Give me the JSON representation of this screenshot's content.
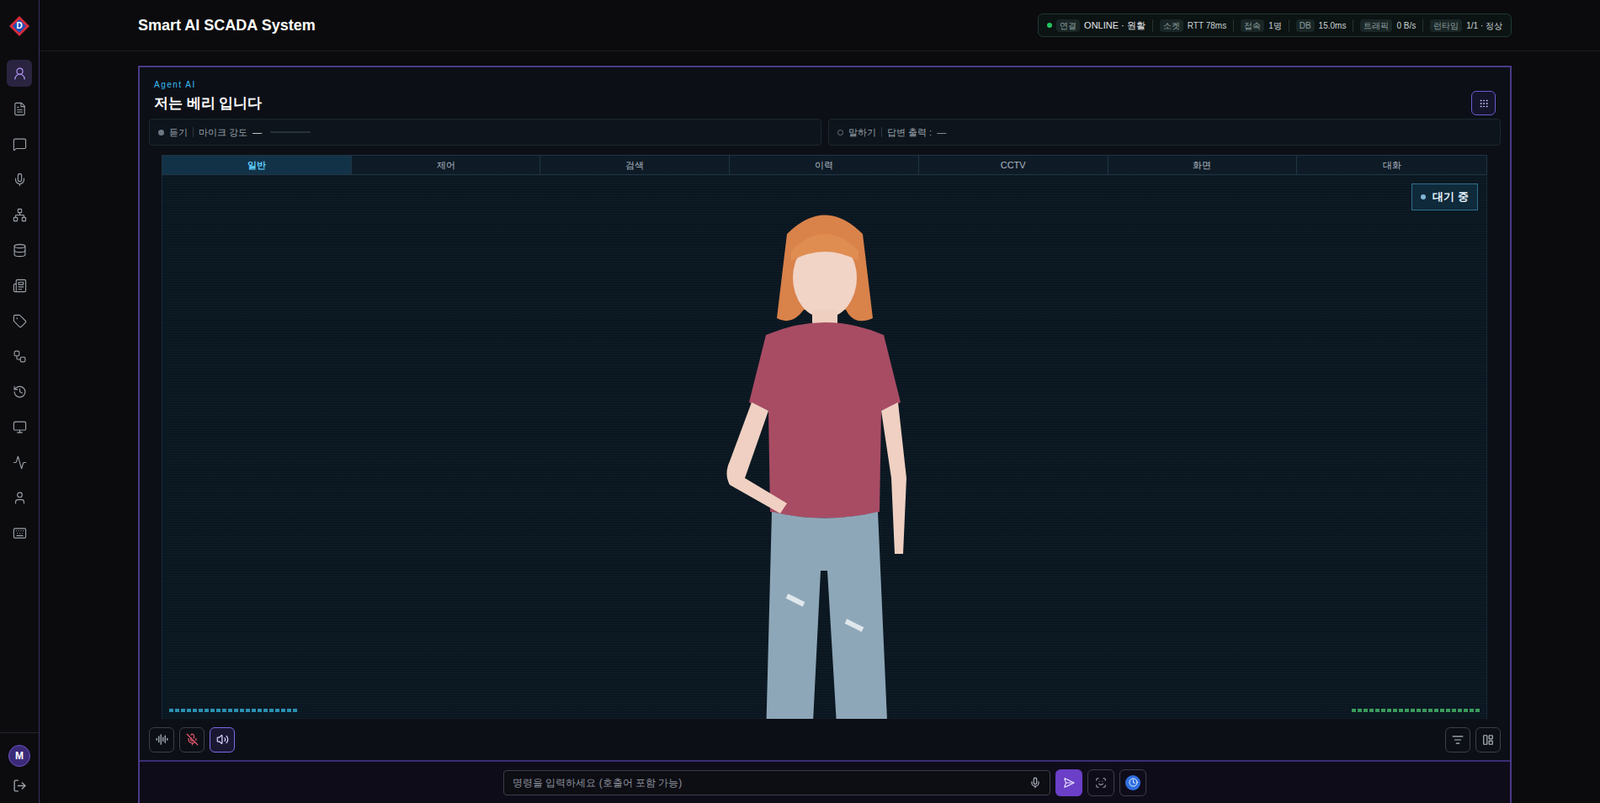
{
  "sidebar": {
    "logo": "D",
    "items": [
      {
        "selected": true
      },
      {
        "selected": false
      },
      {
        "selected": false
      },
      {
        "selected": false
      },
      {
        "selected": false
      },
      {
        "selected": false
      },
      {
        "selected": false
      },
      {
        "selected": false
      },
      {
        "selected": false
      },
      {
        "selected": false
      },
      {
        "selected": false
      },
      {
        "selected": false
      },
      {
        "selected": false
      },
      {
        "selected": false
      }
    ],
    "user_initial": "M"
  },
  "header": {
    "title": "Smart AI SCADA System",
    "connection": {
      "label": "연결",
      "value": "ONLINE · 원활",
      "online": true
    },
    "metrics": [
      {
        "label": "소켓",
        "value": "RTT 78ms"
      },
      {
        "label": "접속",
        "value": "1명"
      },
      {
        "label": "DB",
        "value": "15.0ms"
      },
      {
        "label": "트래픽",
        "value": "0 B/s"
      },
      {
        "label": "런타임",
        "value": "1/1 · 정상"
      }
    ]
  },
  "agent": {
    "subtitle": "Agent AI",
    "title": "저는 베리 입니다"
  },
  "listen": {
    "label": "듣기",
    "meter_label": "마이크 강도",
    "reading": "—",
    "level": 0,
    "active": true
  },
  "speak": {
    "label": "말하기",
    "output_label": "답변 출력 :",
    "reading": "—",
    "active": false
  },
  "tabs": [
    {
      "label": "일반",
      "selected": true
    },
    {
      "label": "제어",
      "selected": false
    },
    {
      "label": "검색",
      "selected": false
    },
    {
      "label": "이력",
      "selected": false
    },
    {
      "label": "CCTV",
      "selected": false
    },
    {
      "label": "화면",
      "selected": false
    },
    {
      "label": "대화",
      "selected": false
    }
  ],
  "status_badge": {
    "label": "대기 중"
  },
  "meters": [
    {
      "level": 1,
      "color": "#2a8fb0"
    },
    {
      "level": 1,
      "color": "#3a9a5c"
    }
  ],
  "voice_controls": {
    "waveform_on": false,
    "mic_muted": true,
    "speaker_on": true
  },
  "input": {
    "placeholder": "명령을 입력하세요 (호출어 포함 가능)",
    "auto_mode_on": true
  }
}
